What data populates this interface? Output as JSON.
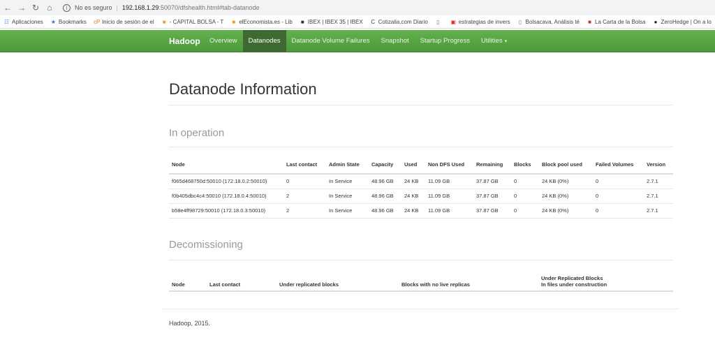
{
  "browser": {
    "security_label": "No es seguro",
    "url_host": "192.168.1.29",
    "url_path": ":50070/dfshealth.html#tab-datanode"
  },
  "bookmarks": [
    {
      "label": "Aplicaciones",
      "icon": "apps-grid-icon",
      "color": "#4285f4"
    },
    {
      "label": "Bookmarks",
      "icon": "star-icon",
      "color": "#3b6fd8"
    },
    {
      "label": "Inicio de sesión de el",
      "icon": "cp-logo-icon",
      "color": "#e8731a"
    },
    {
      "label": "- CAPITAL BOLSA - T",
      "icon": "capital-bolsa-icon",
      "color": "#f29d1f"
    },
    {
      "label": "elEconomista.es - Lib",
      "icon": "eleconomista-icon",
      "color": "#f2a012"
    },
    {
      "label": "IBEX | IBEX 35 | IBEX",
      "icon": "ibex-icon",
      "color": "#333333"
    },
    {
      "label": "Cotizalia.com Diario",
      "icon": "cotizalia-icon",
      "color": "#1f3f66"
    },
    {
      "label": "",
      "icon": "page-icon",
      "color": "#777777"
    },
    {
      "label": "estrategias de invers",
      "icon": "estrategias-icon",
      "color": "#d9302c"
    },
    {
      "label": "Bolsacava. Análisis té",
      "icon": "page-icon",
      "color": "#777777"
    },
    {
      "label": "La Carta de la Bolsa",
      "icon": "carta-bolsa-icon",
      "color": "#c0392b"
    },
    {
      "label": "ZeroHedge | On a lo",
      "icon": "zerohedge-icon",
      "color": "#222222"
    }
  ],
  "navbar": {
    "brand": "Hadoop",
    "items": [
      {
        "label": "Overview",
        "active": false
      },
      {
        "label": "Datanodes",
        "active": true
      },
      {
        "label": "Datanode Volume Failures",
        "active": false
      },
      {
        "label": "Snapshot",
        "active": false
      },
      {
        "label": "Startup Progress",
        "active": false
      },
      {
        "label": "Utilities",
        "active": false
      }
    ]
  },
  "page": {
    "title": "Datanode Information",
    "in_operation": {
      "heading": "In operation",
      "columns": [
        "Node",
        "Last contact",
        "Admin State",
        "Capacity",
        "Used",
        "Non DFS Used",
        "Remaining",
        "Blocks",
        "Block pool used",
        "Failed Volumes",
        "Version"
      ],
      "rows": [
        [
          "f065d468750d:50010 (172.18.0.2:50010)",
          "0",
          "In Service",
          "48.96 GB",
          "24 KB",
          "11.09 GB",
          "37.87 GB",
          "0",
          "24 KB (0%)",
          "0",
          "2.7.1"
        ],
        [
          "f0b405dbc4c4:50010 (172.18.0.4:50010)",
          "2",
          "In Service",
          "48.96 GB",
          "24 KB",
          "11.09 GB",
          "37.87 GB",
          "0",
          "24 KB (0%)",
          "0",
          "2.7.1"
        ],
        [
          "b58e4ff98729:50010 (172.18.0.3:50010)",
          "2",
          "In Service",
          "48.96 GB",
          "24 KB",
          "11.09 GB",
          "37.87 GB",
          "0",
          "24 KB (0%)",
          "0",
          "2.7.1"
        ]
      ]
    },
    "decomissioning": {
      "heading": "Decomissioning",
      "columns": [
        "Node",
        "Last contact",
        "Under replicated blocks",
        "Blocks with no live replicas",
        "Under Replicated Blocks",
        "In files under construction"
      ]
    },
    "footer": "Hadoop, 2015."
  }
}
